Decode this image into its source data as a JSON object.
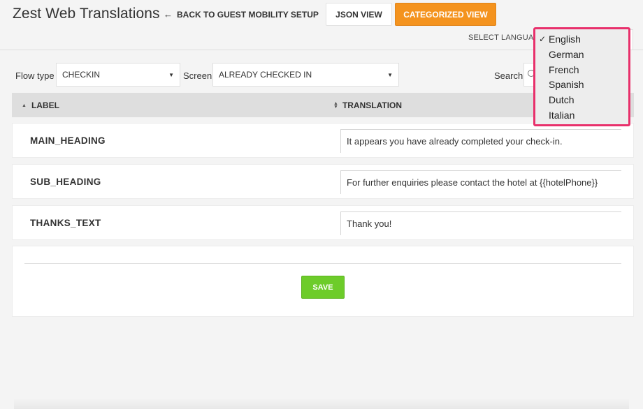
{
  "header": {
    "title": "Zest Web Translations",
    "back_label": "BACK TO GUEST MOBILITY SETUP",
    "json_view_label": "JSON VIEW",
    "categorized_view_label": "CATEGORIZED VIEW",
    "select_language_label": "SELECT LANGUAGE"
  },
  "filters": {
    "flow_type_label": "Flow type",
    "flow_type_value": "CHECKIN",
    "screen_label": "Screen",
    "screen_value": "ALREADY CHECKED IN",
    "search_label": "Search",
    "search_placeholder": ""
  },
  "table": {
    "columns": {
      "label": "LABEL",
      "translation": "TRANSLATION"
    },
    "rows": [
      {
        "key": "MAIN_HEADING",
        "translation": "It appears you have already completed your check-in."
      },
      {
        "key": "SUB_HEADING",
        "translation": "For further enquiries please contact the hotel at {{hotelPhone}}"
      },
      {
        "key": "THANKS_TEXT",
        "translation": "Thank you!"
      }
    ]
  },
  "save_label": "SAVE",
  "language_menu": {
    "selected": "English",
    "options": [
      "English",
      "German",
      "French",
      "Spanish",
      "Dutch",
      "Italian"
    ]
  },
  "icons": {
    "back": "left-arrow-icon",
    "caret": "caret-down-icon",
    "sort": "sort-icon",
    "check": "checkmark-icon",
    "search": "search-icon"
  },
  "colors": {
    "categorized_button": "#f4931e",
    "save_button": "#6dcc2a",
    "dropdown_highlight": "#e8306b"
  }
}
